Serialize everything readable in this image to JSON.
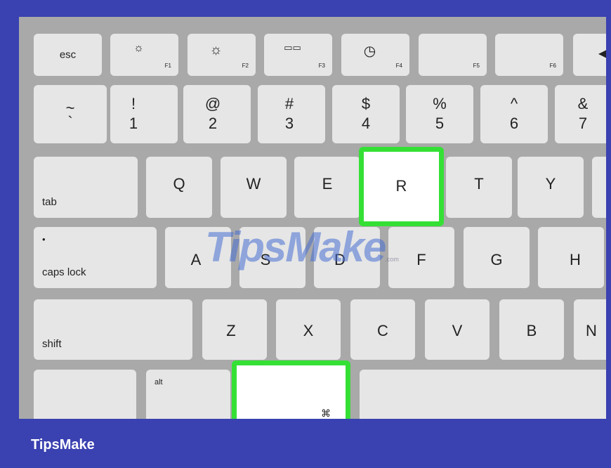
{
  "keys": {
    "esc": "esc",
    "f1": {
      "icon": "☼",
      "label": "F1"
    },
    "f2": {
      "icon": "☼",
      "label": "F2"
    },
    "f3": {
      "icon": "▭▭",
      "label": "F3"
    },
    "f4": {
      "icon": "◷",
      "label": "F4"
    },
    "f5": "F5",
    "f6": "F6",
    "f7_icon": "◀",
    "tilde": {
      "top": "~",
      "bottom": "`"
    },
    "n1": {
      "top": "!",
      "bottom": "1"
    },
    "n2": {
      "top": "@",
      "bottom": "2"
    },
    "n3": {
      "top": "#",
      "bottom": "3"
    },
    "n4": {
      "top": "$",
      "bottom": "4"
    },
    "n5": {
      "top": "%",
      "bottom": "5"
    },
    "n6": {
      "top": "^",
      "bottom": "6"
    },
    "n7": {
      "top": "&",
      "bottom": "7"
    },
    "tab": "tab",
    "q": "Q",
    "w": "W",
    "e": "E",
    "r": "R",
    "t": "T",
    "y": "Y",
    "caps_dot": "•",
    "caps": "caps lock",
    "a": "A",
    "s": "S",
    "d": "D",
    "f": "F",
    "g": "G",
    "h": "H",
    "shift": "shift",
    "z": "Z",
    "x": "X",
    "c": "C",
    "v": "V",
    "b": "B",
    "n": "N",
    "alt": "alt",
    "cmd_partial": "⌘"
  },
  "highlight_color": "#35e035",
  "watermark": {
    "text": "TipsMake",
    "suffix": ".com"
  },
  "brand": "TipsMake"
}
